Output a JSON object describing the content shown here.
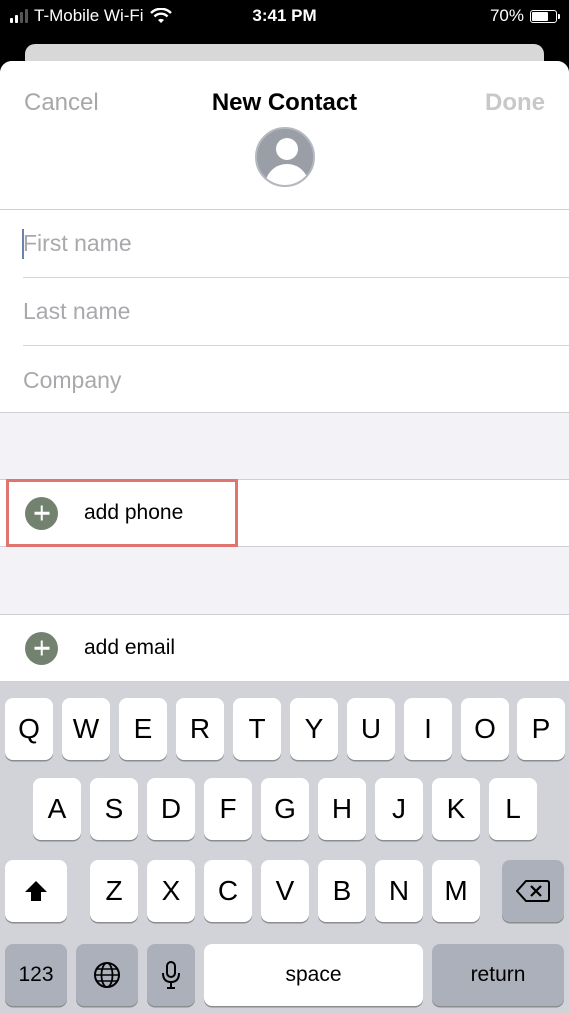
{
  "status_bar": {
    "carrier": "T-Mobile Wi-Fi",
    "time": "3:41 PM",
    "battery": "70%"
  },
  "nav": {
    "cancel": "Cancel",
    "title": "New Contact",
    "done": "Done"
  },
  "fields": {
    "first_name_placeholder": "First name",
    "last_name_placeholder": "Last name",
    "company_placeholder": "Company"
  },
  "actions": {
    "add_phone": "add phone",
    "add_email": "add email"
  },
  "keyboard": {
    "row1": [
      "Q",
      "W",
      "E",
      "R",
      "T",
      "Y",
      "U",
      "I",
      "O",
      "P"
    ],
    "row2": [
      "A",
      "S",
      "D",
      "F",
      "G",
      "H",
      "J",
      "K",
      "L"
    ],
    "row3": [
      "Z",
      "X",
      "C",
      "V",
      "B",
      "N",
      "M"
    ],
    "numbers": "123",
    "space": "space",
    "return": "return"
  },
  "colors": {
    "accent_disabled": "#a8a8a8",
    "plus_button": "#72826f",
    "highlight": "#e07570"
  }
}
